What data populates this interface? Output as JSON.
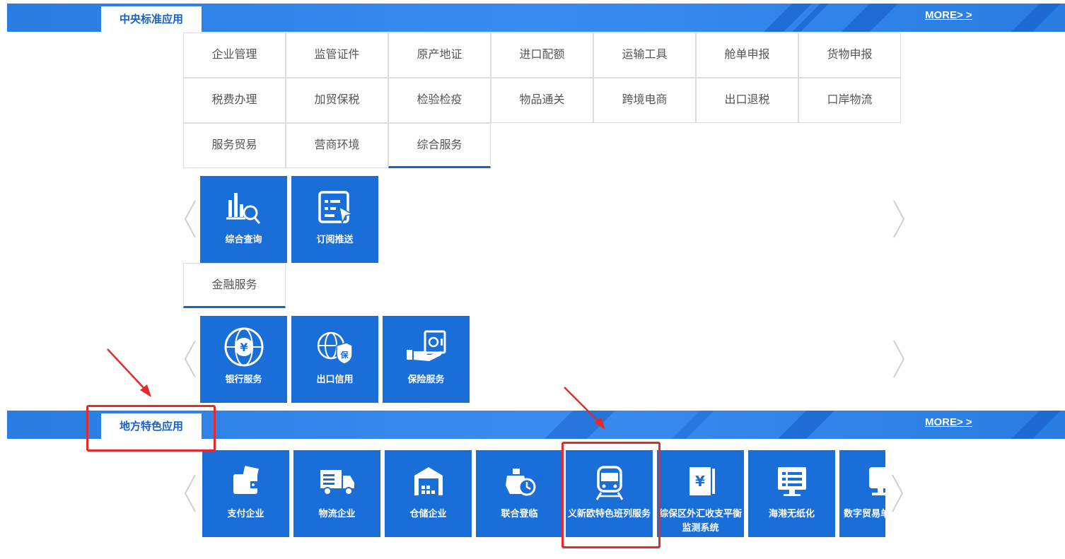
{
  "central": {
    "title": "中央标准应用",
    "more": "MORE> >"
  },
  "categories": [
    [
      "企业管理",
      "监管证件",
      "原产地证",
      "进口配额",
      "运输工具",
      "舱单申报",
      "货物申报"
    ],
    [
      "税费办理",
      "加贸保税",
      "检验检疫",
      "物品通关",
      "跨境电商",
      "出口退税",
      "口岸物流"
    ],
    [
      "服务贸易",
      "营商环境",
      "综合服务"
    ]
  ],
  "active_category": "综合服务",
  "comprehensive_tiles": [
    {
      "label": "综合查询",
      "icon": "chart-search-icon"
    },
    {
      "label": "订阅推送",
      "icon": "subscribe-screen-icon"
    }
  ],
  "finance": {
    "tab_label": "金融服务",
    "tiles": [
      {
        "label": "银行服务",
        "icon": "globe-yen-icon"
      },
      {
        "label": "出口信用",
        "icon": "globe-shield-icon"
      },
      {
        "label": "保险服务",
        "icon": "hand-safe-icon"
      }
    ]
  },
  "local": {
    "title": "地方特色应用",
    "more": "MORE> >"
  },
  "local_tiles": [
    {
      "label": "支付企业",
      "icon": "wallet-icon"
    },
    {
      "label": "物流企业",
      "icon": "truck-icon"
    },
    {
      "label": "仓储企业",
      "icon": "warehouse-icon"
    },
    {
      "label": "联合登临",
      "icon": "ship-clock-icon"
    },
    {
      "label": "义新欧特色班列服务",
      "icon": "train-icon"
    },
    {
      "label": "综保区外汇收支平衡监测系统",
      "icon": "ledger-yen-icon"
    },
    {
      "label": "海港无纸化",
      "icon": "monitor-icon"
    },
    {
      "label": "数字贸易单",
      "icon": "digital-trade-icon"
    }
  ],
  "colors": {
    "banner": "#2a7de0",
    "tile": "#1a6ed8",
    "accent": "#1565d8",
    "annotation": "#e52a2a"
  }
}
